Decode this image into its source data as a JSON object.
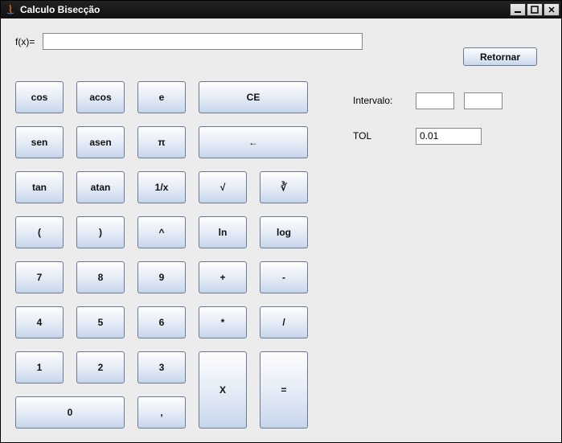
{
  "window": {
    "title": "Calculo Bisecção"
  },
  "fx": {
    "label": "f(x)=",
    "value": ""
  },
  "return_btn": "Retornar",
  "side": {
    "intervalo_label": "Intervalo:",
    "intervalo_a": "",
    "intervalo_b": "",
    "tol_label": "TOL",
    "tol_value": "0.01"
  },
  "keys": {
    "cos": "cos",
    "acos": "acos",
    "e": "e",
    "ce": "CE",
    "sen": "sen",
    "asen": "asen",
    "pi": "π",
    "back": "←",
    "tan": "tan",
    "atan": "atan",
    "inv": "1/x",
    "sqrt": "√",
    "cbrt": "∛",
    "lpar": "(",
    "rpar": ")",
    "pow": "^",
    "ln": "ln",
    "log": "log",
    "n7": "7",
    "n8": "8",
    "n9": "9",
    "plus": "+",
    "minus": "-",
    "n4": "4",
    "n5": "5",
    "n6": "6",
    "mul": "*",
    "div": "/",
    "n1": "1",
    "n2": "2",
    "n3": "3",
    "xvar": "X",
    "eq": "=",
    "n0": "0",
    "comma": ","
  }
}
